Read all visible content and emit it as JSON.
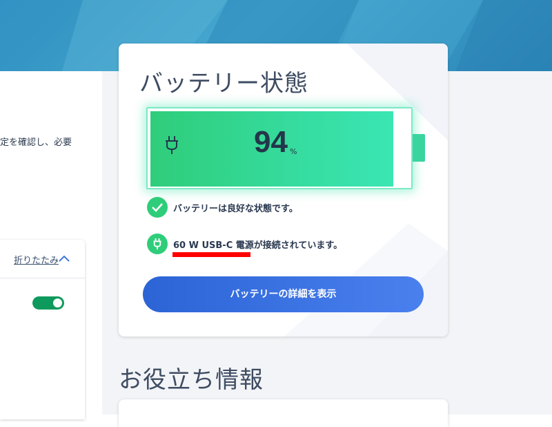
{
  "left_panel": {
    "description_fragment": "定を確認し、必要",
    "collapse_label": "折りたたみ",
    "toggle_on": true
  },
  "battery_card": {
    "title": "バッテリー状態",
    "percent": "94",
    "percent_unit": "%",
    "charge_level": 0.94,
    "status_health": "バッテリーは良好な状態です。",
    "status_power": "60 W USB-C 電源が接続されています。",
    "detail_button": "バッテリーの詳細を表示"
  },
  "section": {
    "title": "お役立ち情報"
  },
  "colors": {
    "accent_green": "#2fcd7a",
    "button_blue": "#3a72e2",
    "toggle_green": "#0e9a5c",
    "banner_blue": "#3a9ccb",
    "annotation_red": "#ff0000"
  },
  "icons": {
    "battery": "plug-icon",
    "health": "check-icon",
    "power": "plug-icon",
    "collapse": "chevron-up-icon"
  }
}
